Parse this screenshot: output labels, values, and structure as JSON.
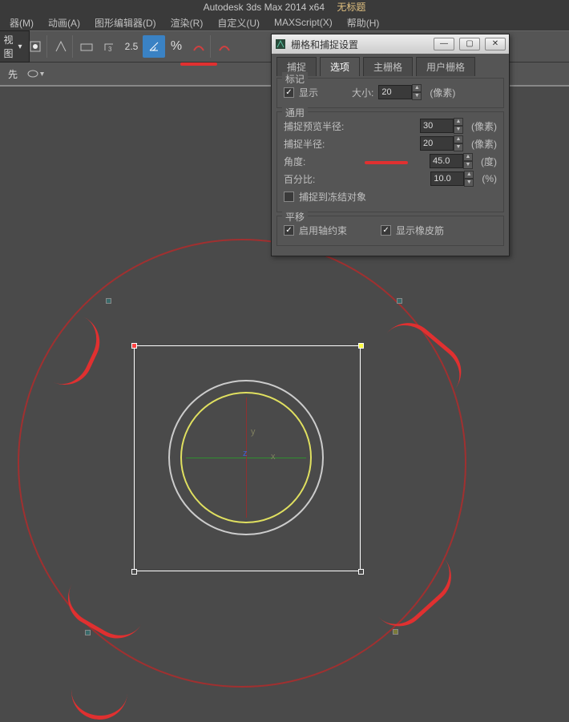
{
  "app": {
    "title": "Autodesk 3ds Max  2014 x64",
    "doc": "无标题"
  },
  "menu": {
    "items": [
      {
        "label": "器(M)"
      },
      {
        "label": "动画(A)"
      },
      {
        "label": "图形编辑器(D)"
      },
      {
        "label": "渲染(R)"
      },
      {
        "label": "自定义(U)"
      },
      {
        "label": "MAXScript(X)"
      },
      {
        "label": "帮助(H)"
      }
    ]
  },
  "toolbar": {
    "viewsel": "视图",
    "num": "2.5",
    "percent": "%",
    "gear_label": "先"
  },
  "dialog": {
    "title": "栅格和捕捉设置",
    "tabs": {
      "snap": "捕捉",
      "options": "选项",
      "home": "主栅格",
      "user": "用户栅格"
    },
    "group_mark": {
      "title": "标记",
      "display": "显示",
      "size_lbl": "大小:",
      "size_val": "20",
      "size_unit": "(像素)"
    },
    "group_general": {
      "title": "通用",
      "preview_radius_lbl": "捕捉预览半径:",
      "preview_radius_val": "30",
      "preview_unit": "(像素)",
      "snap_radius_lbl": "捕捉半径:",
      "snap_radius_val": "20",
      "snap_unit": "(像素)",
      "angle_lbl": "角度:",
      "angle_val": "45.0",
      "angle_unit": "(度)",
      "percent_lbl": "百分比:",
      "percent_val": "10.0",
      "percent_unit": "(%)",
      "frozen": "捕捉到冻结对象"
    },
    "group_pan": {
      "title": "平移",
      "axis_constraint": "启用轴约束",
      "rubber": "显示橡皮筋"
    }
  },
  "gizmo": {
    "x": "x",
    "y": "y",
    "z": "z"
  }
}
